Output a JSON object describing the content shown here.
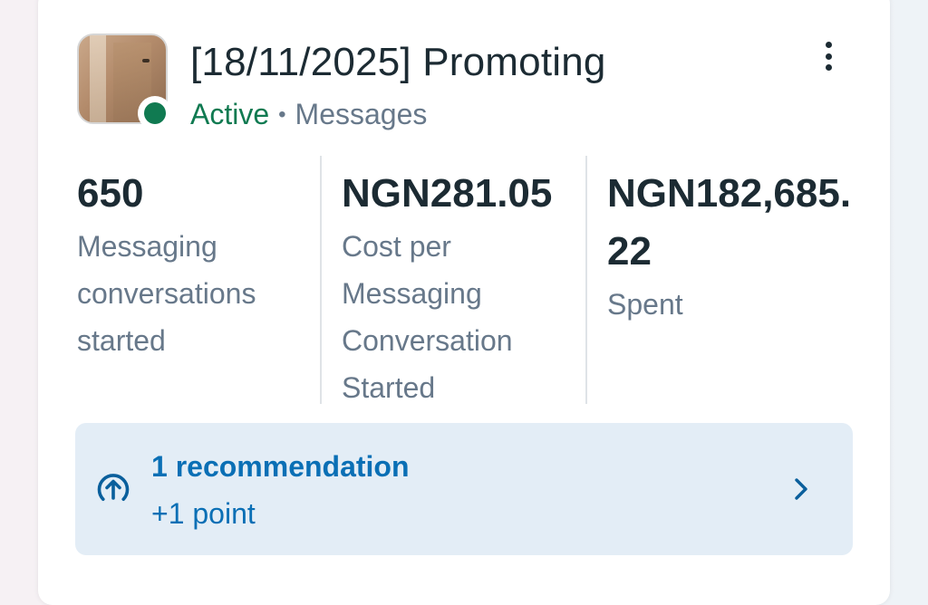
{
  "campaign": {
    "title": "[18/11/2025] Promoting",
    "status": "Active",
    "separator": "•",
    "objective": "Messages",
    "thumbnail_icon": "campaign-thumbnail-image",
    "status_color": "#107a51"
  },
  "metrics": [
    {
      "value": "650",
      "label": "Messaging conversations started"
    },
    {
      "value": "NGN281.05",
      "label": "Cost per Messaging Conversation Started"
    },
    {
      "value": "NGN182,685.22",
      "label": "Spent"
    }
  ],
  "recommendation": {
    "title": "1 recommendation",
    "points": "+1 point",
    "icon": "arrow-up-circle-icon",
    "accent": "#0a6fb5"
  }
}
